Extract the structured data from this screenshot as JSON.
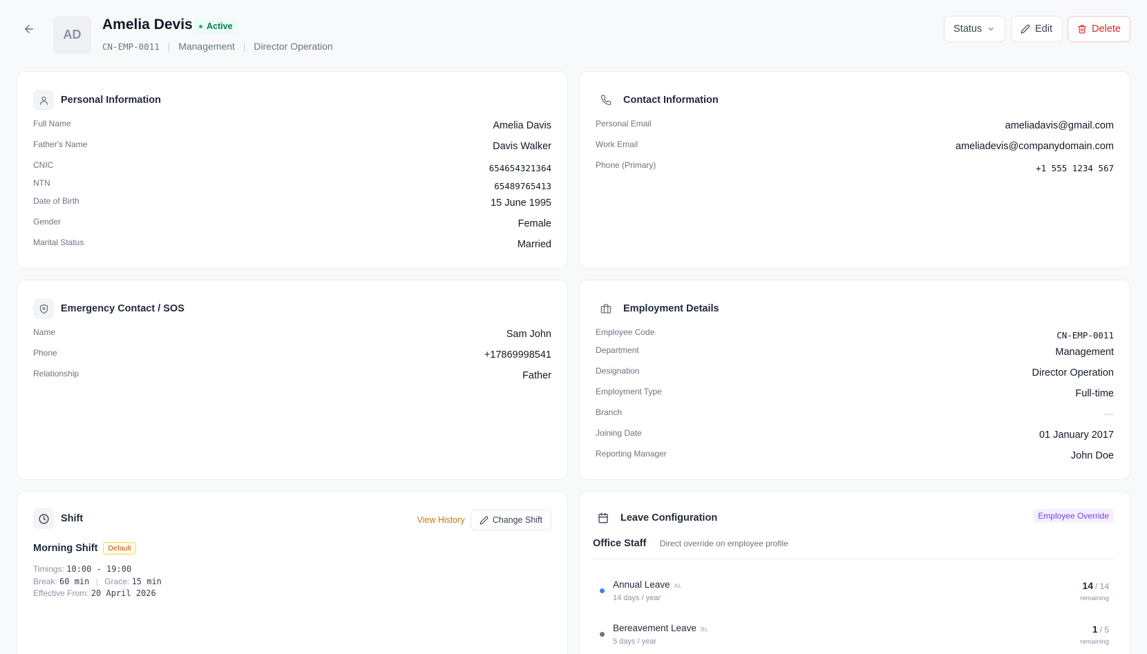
{
  "header": {
    "initials": "AD",
    "name": "Amelia Devis",
    "status": "Active",
    "employee_code": "CN-EMP-0011",
    "department": "Management",
    "designation": "Director Operation",
    "status_button": "Status",
    "edit_button": "Edit",
    "delete_button": "Delete"
  },
  "personal": {
    "title": "Personal Information",
    "fields": [
      {
        "label": "Full Name",
        "value": "Amelia Davis"
      },
      {
        "label": "Father's Name",
        "value": "Davis Walker"
      },
      {
        "label": "CNIC",
        "value": "654654321364"
      },
      {
        "label": "NTN",
        "value": "65489765413"
      },
      {
        "label": "Date of Birth",
        "value": "15 June 1995"
      },
      {
        "label": "Gender",
        "value": "Female"
      },
      {
        "label": "Marital Status",
        "value": "Married"
      }
    ]
  },
  "contact": {
    "title": "Contact Information",
    "fields": [
      {
        "label": "Personal Email",
        "value": "ameliadavis@gmail.com"
      },
      {
        "label": "Work Email",
        "value": "ameliadevis@companydomain.com"
      },
      {
        "label": "Phone (Primary)",
        "value": "+1 555 1234 567"
      }
    ]
  },
  "emergency": {
    "title": "Emergency Contact / SOS",
    "fields": [
      {
        "label": "Name",
        "value": "Sam John"
      },
      {
        "label": "Phone",
        "value": "+17869998541"
      },
      {
        "label": "Relationship",
        "value": "Father"
      }
    ]
  },
  "employment": {
    "title": "Employment Details",
    "fields": [
      {
        "label": "Employee Code",
        "value": "CN-EMP-0011"
      },
      {
        "label": "Department",
        "value": "Management"
      },
      {
        "label": "Designation",
        "value": "Director Operation"
      },
      {
        "label": "Employment Type",
        "value": "Full-time"
      },
      {
        "label": "Branch",
        "value": "—"
      },
      {
        "label": "Joining Date",
        "value": "01 January 2017"
      },
      {
        "label": "Reporting Manager",
        "value": "John Doe"
      }
    ]
  },
  "shift": {
    "title": "Shift",
    "view_history": "View History",
    "change_shift": "Change Shift",
    "name": "Morning Shift",
    "badge": "Default",
    "timings_label": "Timings:",
    "timings_value": "10:00 - 19:00",
    "break_label": "Break:",
    "break_value": "60 min",
    "grace_label": "Grace:",
    "grace_value": "15 min",
    "effective_label": "Effective From:",
    "effective_value": "20 April 2026"
  },
  "leave": {
    "title": "Leave Configuration",
    "badge": "Employee Override",
    "group_name": "Office Staff",
    "group_desc": "Direct override on employee profile",
    "items": [
      {
        "name": "Annual Leave",
        "code": "AL",
        "sub": "14 days / year",
        "remaining": "14",
        "total": "/ 14",
        "remaining_label": "remaining",
        "color": "#3b82f6"
      },
      {
        "name": "Bereavement Leave",
        "code": "BL",
        "sub": "5 days / year",
        "remaining": "1",
        "total": "/ 5",
        "remaining_label": "remaining",
        "color": "#64748b"
      }
    ]
  }
}
